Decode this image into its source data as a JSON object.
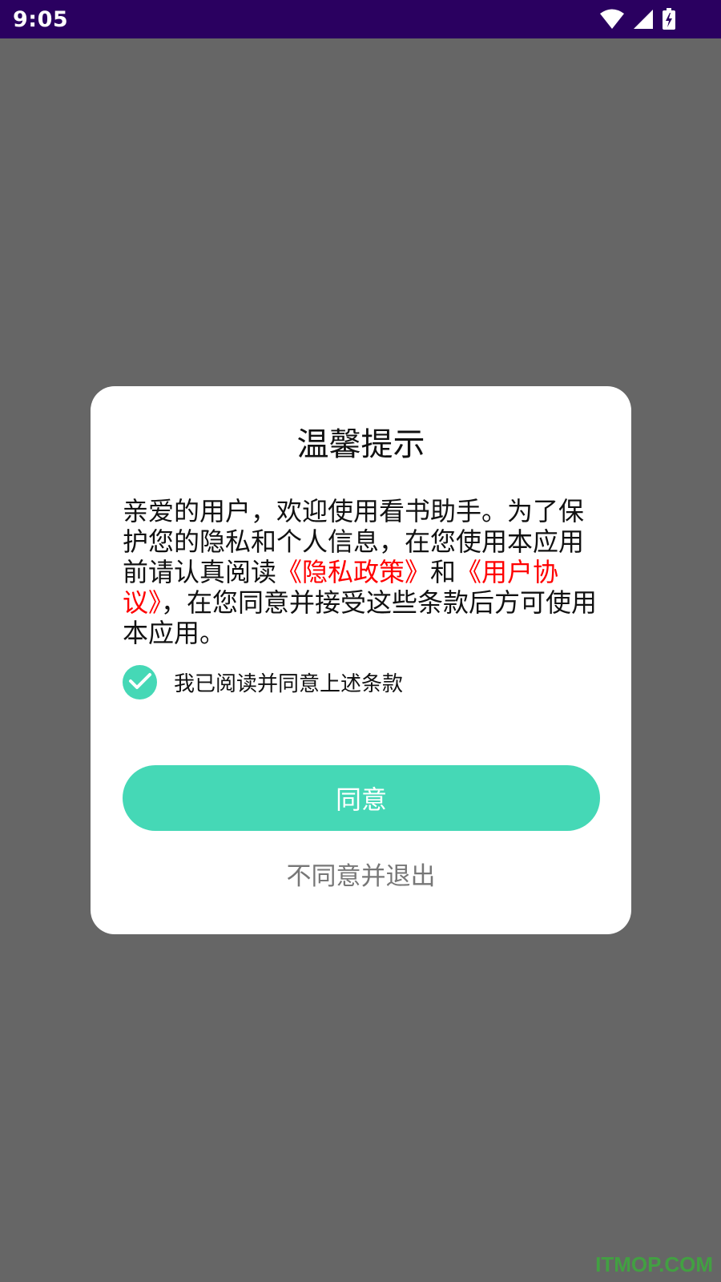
{
  "status_bar": {
    "time": "9:05",
    "icons": [
      "wifi-icon",
      "signal-icon",
      "battery-charging-icon"
    ]
  },
  "dialog": {
    "title": "温馨提示",
    "message": {
      "part1": "亲爱的用户，欢迎使用看书助手。为了保护您的隐私和个人信息，在您使用本应用前请认真阅读",
      "privacy_link": "《隐私政策》",
      "part2": "和",
      "agreement_link": "《用户协议》",
      "part3": "，在您同意并接受这些条款后方可使用本应用。"
    },
    "checkbox": {
      "label": "我已阅读并同意上述条款",
      "checked": true
    },
    "agree_button": "同意",
    "exit_button": "不同意并退出"
  },
  "watermark": "ITMOP.COM",
  "colors": {
    "accent": "#45d8b6",
    "link": "#ff0000",
    "status_bar": "#2a0060",
    "overlay": "#666666"
  }
}
